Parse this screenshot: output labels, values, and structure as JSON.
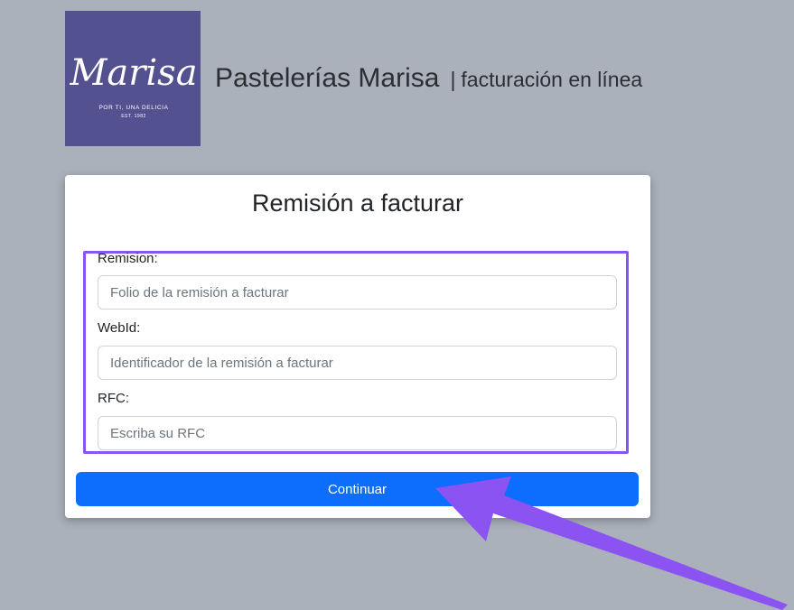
{
  "header": {
    "logo": {
      "script_text": "Marisa",
      "tagline": "POR TI, UNA DELICIA",
      "established": "EST. 1982",
      "background": "#545191"
    },
    "brand_name": "Pastelerías Marisa",
    "separator": "|",
    "subtitle": "facturación en línea"
  },
  "form": {
    "title": "Remisión a facturar",
    "fields": [
      {
        "label": "Remision:",
        "placeholder": "Folio de la remisión a facturar",
        "value": ""
      },
      {
        "label": "WebId:",
        "placeholder": "Identificador de la remisión a facturar",
        "value": ""
      },
      {
        "label": "RFC:",
        "placeholder": "Escriba su RFC",
        "value": ""
      }
    ],
    "submit_label": "Continuar"
  },
  "colors": {
    "page_background": "#aab1bb",
    "primary_button": "#0d6efd",
    "highlight_annotation": "#8b54f2"
  },
  "annotation": {
    "icon": "arrow-pointer-icon"
  }
}
